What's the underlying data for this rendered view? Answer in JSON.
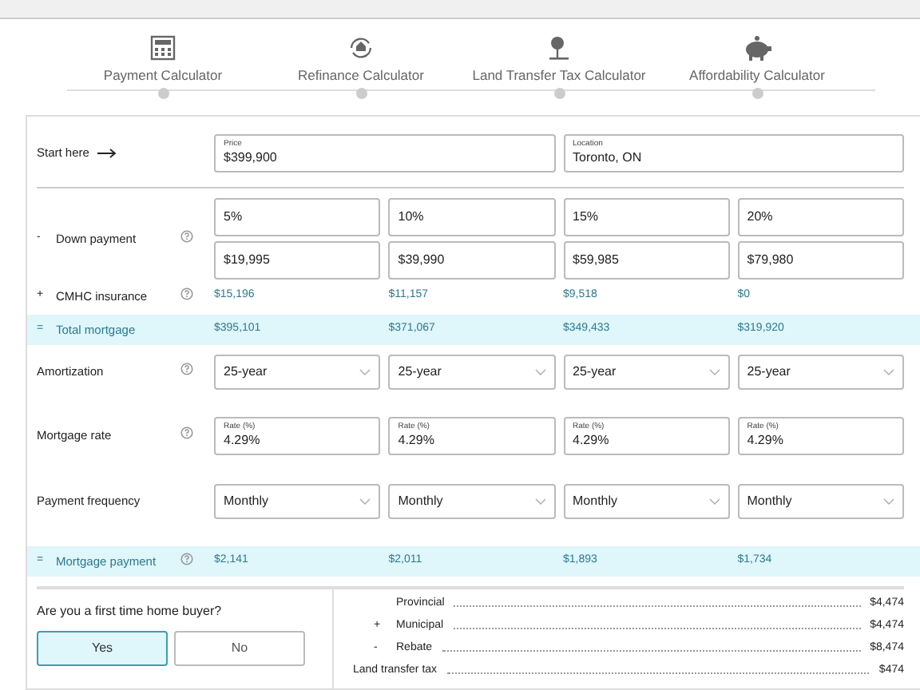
{
  "steps": [
    {
      "label": "Payment Calculator"
    },
    {
      "label": "Refinance Calculator"
    },
    {
      "label": "Land Transfer Tax Calculator"
    },
    {
      "label": "Affordability Calculator"
    }
  ],
  "start": {
    "label": "Start here",
    "fields": [
      {
        "label": "Price",
        "value": "$399,900"
      },
      {
        "label": "Location",
        "value": "Toronto, ON"
      }
    ]
  },
  "rows": [
    {
      "kind": "down",
      "sign": "-",
      "label": "Down payment",
      "help": true,
      "percents": [
        "5%",
        "10%",
        "15%",
        "20%"
      ],
      "amounts": [
        "$19,995",
        "$39,990",
        "$59,985",
        "$79,980"
      ]
    },
    {
      "kind": "value",
      "sign": "+",
      "label": "CMHC insurance",
      "help": true,
      "highlight": false,
      "values": [
        "$15,196",
        "$11,157",
        "$9,518",
        "$0"
      ]
    },
    {
      "kind": "value",
      "sign": "=",
      "label": "Total mortgage",
      "help": false,
      "highlight": true,
      "values": [
        "$395,101",
        "$371,067",
        "$349,433",
        "$319,920"
      ]
    },
    {
      "kind": "select",
      "label": "Amortization",
      "help": true,
      "values": [
        "25-year",
        "25-year",
        "25-year",
        "25-year"
      ]
    },
    {
      "kind": "rate",
      "label": "Mortgage rate",
      "help": true,
      "field_label": [
        "Rate (%)",
        "Rate (%)",
        "Rate (%)",
        "Rate (%)"
      ],
      "values": [
        "4.29%",
        "4.29%",
        "4.29%",
        "4.29%"
      ]
    },
    {
      "kind": "select",
      "label": "Payment frequency",
      "help": false,
      "values": [
        "Monthly",
        "Monthly",
        "Monthly",
        "Monthly"
      ]
    },
    {
      "kind": "value",
      "sign": "=",
      "label": "Mortgage payment",
      "help": true,
      "highlight": true,
      "values": [
        "$2,141",
        "$2,011",
        "$1,893",
        "$1,734"
      ]
    }
  ],
  "first_time": {
    "question": "Are you a first time home buyer?",
    "options": [
      {
        "label": "Yes",
        "selected": true
      },
      {
        "label": "No",
        "selected": false
      }
    ]
  },
  "land_transfer": {
    "items": [
      {
        "label": "Provincial",
        "value": "$4,474"
      },
      {
        "sign": "+",
        "label": "Municipal",
        "value": "$4,474"
      },
      {
        "sign": "-",
        "label": "Rebate",
        "value": "$8,474"
      }
    ],
    "total": {
      "label": "Land transfer tax",
      "value": "$474"
    }
  }
}
